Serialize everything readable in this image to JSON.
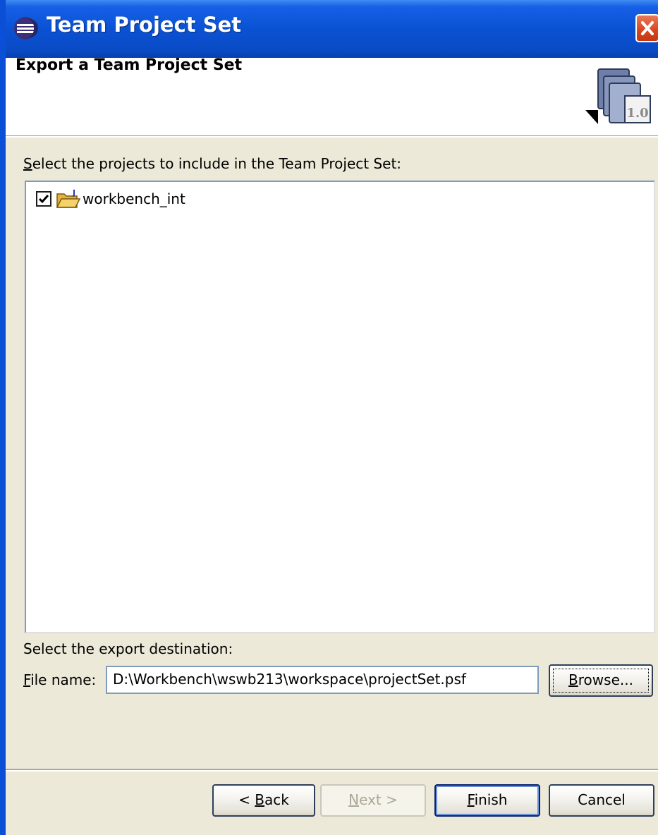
{
  "window": {
    "title": "Team Project Set",
    "app_icon": "eclipse-icon",
    "close_icon": "close-icon"
  },
  "header": {
    "title": "Export a Team Project Set",
    "icon": "team-project-set-wizard-icon",
    "icon_badge": "1.0"
  },
  "projects": {
    "label_prefix": "S",
    "label_rest": "elect the projects to include in the Team Project Set:",
    "items": [
      {
        "label": "workbench_int",
        "checked": true,
        "icon": "java-project-folder-icon"
      }
    ]
  },
  "destination": {
    "label": "Select the export destination:",
    "file_label_prefix": "F",
    "file_label_rest": "ile name:",
    "file_value": "D:\\Workbench\\wswb213\\workspace\\projectSet.psf",
    "browse_prefix": "B",
    "browse_rest": "rowse..."
  },
  "buttons": {
    "back_pre": "< ",
    "back_ul": "B",
    "back_rest": "ack",
    "next_ul": "N",
    "next_rest": "ext >",
    "finish_ul": "F",
    "finish_rest": "inish",
    "cancel": "Cancel"
  },
  "colors": {
    "titlebar": "#0a52d4",
    "dialog_bg": "#ece9d8",
    "close_red": "#d8451f"
  }
}
